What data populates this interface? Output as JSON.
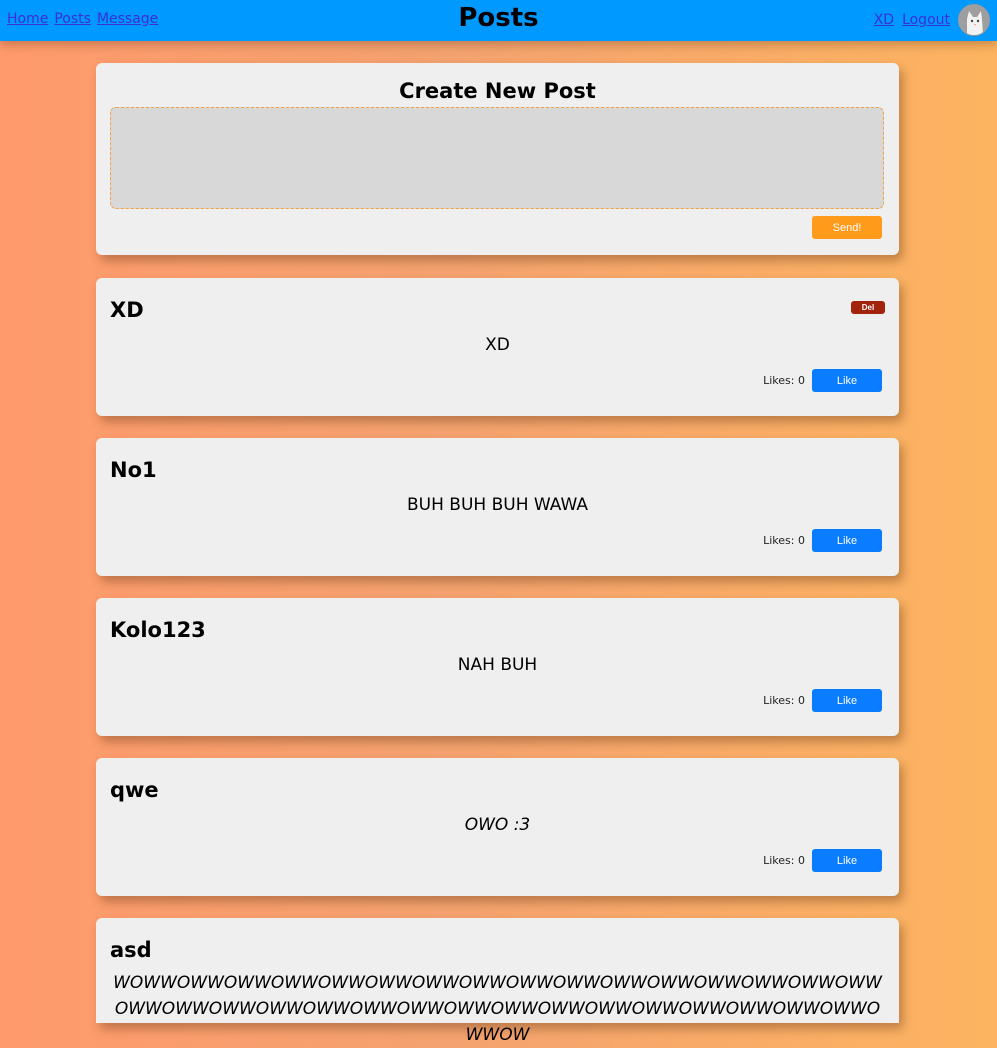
{
  "nav": {
    "links": [
      "Home",
      "Posts",
      "Message"
    ],
    "title": "Posts",
    "user": "XD",
    "logout": "Logout"
  },
  "create": {
    "title": "Create New Post",
    "placeholder": "",
    "send_label": "Send!"
  },
  "posts": [
    {
      "author": "XD",
      "content": "XD",
      "likes_label": "Likes: 0",
      "like_label": "Like",
      "delete_label": "Del"
    },
    {
      "author": "No1",
      "content": "BUH BUH BUH WAWA",
      "likes_label": "Likes: 0",
      "like_label": "Like"
    },
    {
      "author": "Kolo123",
      "content": "NAH BUH",
      "likes_label": "Likes: 0",
      "like_label": "Like"
    },
    {
      "author": "qwe",
      "content": "OWO :3",
      "likes_label": "Likes: 0",
      "like_label": "Like"
    },
    {
      "author": "asd",
      "content": "WOWWOWWOWWOWWOWWOWWOWWOWWOWWOWWOWWOWWOWWOWWOWWOWWOWWOWWOWWOWWOWWOWWOWWOWWOWWOWWOWWOWWOWWOWWOWWOWWOWWOW"
    }
  ],
  "colors": {
    "topbar": "#0099ff",
    "send": "#ff9a1a",
    "like": "#0a7cff",
    "delete": "#a3240d"
  },
  "icons": {
    "avatar": "cat-avatar-icon"
  }
}
